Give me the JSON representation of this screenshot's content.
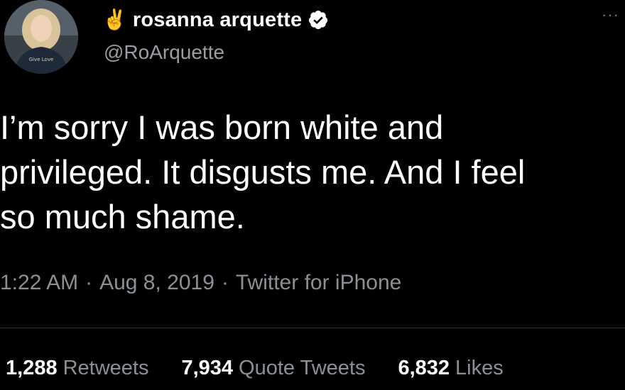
{
  "author": {
    "emoji": "✌️",
    "display_name": "rosanna arquette",
    "handle": "@RoArquette",
    "verified": true,
    "avatar_icon": "profile-photo",
    "avatar_shirt_text": "Give Love"
  },
  "menu_icon": "more-icon",
  "more_label": "···",
  "tweet": {
    "text": "I’m sorry I was born white and\nprivileged. It disgusts me. And I feel\nso much shame."
  },
  "meta": {
    "time": "1:22 AM",
    "separator": "·",
    "date": "Aug 8, 2019",
    "source": "Twitter for iPhone"
  },
  "stats": {
    "retweets_count": "1,288",
    "retweets_label": "Retweets",
    "quotes_count": "7,934",
    "quotes_label": "Quote Tweets",
    "likes_count": "6,832",
    "likes_label": "Likes"
  },
  "colors": {
    "background": "#000000",
    "primary_text": "#ffffff",
    "secondary_text": "#8b9096",
    "verified_badge": "#ffffff",
    "divider": "#2f3336"
  }
}
